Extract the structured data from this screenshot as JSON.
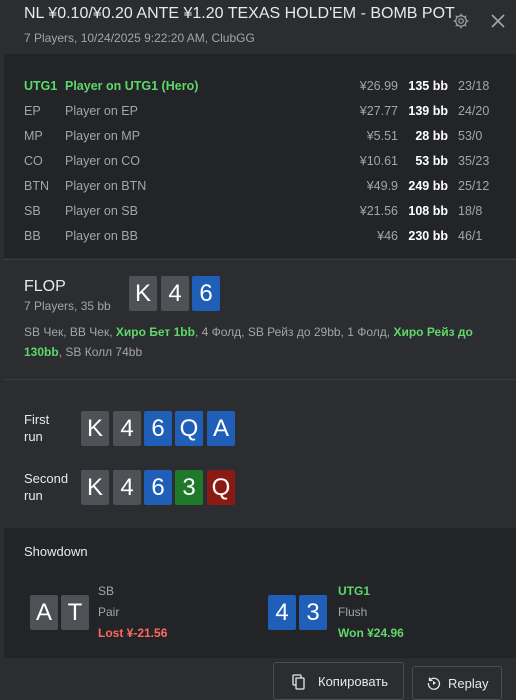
{
  "header": {
    "title": "NL ¥0.10/¥0.20 ANTE ¥1.20 TEXAS HOLD'EM - BOMB POT",
    "subtitle": "7 Players, 10/24/2025 9:22:20 AM, ClubGG",
    "icons": [
      "gear-icon",
      "close-icon"
    ]
  },
  "players": [
    {
      "pos": "UTG1",
      "name": "Player on UTG1 (Hero)",
      "stack": "¥26.99",
      "bb": "135 bb",
      "vp": "23/18",
      "hero": true
    },
    {
      "pos": "EP",
      "name": "Player on EP",
      "stack": "¥27.77",
      "bb": "139 bb",
      "vp": "24/20"
    },
    {
      "pos": "MP",
      "name": "Player on MP",
      "stack": "¥5.51",
      "bb": "28 bb",
      "vp": "53/0"
    },
    {
      "pos": "CO",
      "name": "Player on CO",
      "stack": "¥10.61",
      "bb": "53 bb",
      "vp": "35/23"
    },
    {
      "pos": "BTN",
      "name": "Player on BTN",
      "stack": "¥49.9",
      "bb": "249 bb",
      "vp": "25/12"
    },
    {
      "pos": "SB",
      "name": "Player on SB",
      "stack": "¥21.56",
      "bb": "108 bb",
      "vp": "18/8"
    },
    {
      "pos": "BB",
      "name": "Player on BB",
      "stack": "¥46",
      "bb": "230 bb",
      "vp": "46/1"
    }
  ],
  "flop": {
    "label": "FLOP",
    "sub": "7 Players, 35 bb",
    "cards": [
      "K",
      "4",
      "6"
    ],
    "actions": {
      "a1": "SB Чек, BB Чек, ",
      "a2": "Хиро Бет 1bb",
      "a3": ", 4 Фолд, SB Рейз до 29bb, 1 Фолд, ",
      "a4": "Хиро Рейз до 130bb",
      "a5": ", SB Колл 74bb"
    }
  },
  "runs": {
    "first": {
      "label1": "First",
      "label2": "run",
      "cards": [
        "K",
        "4",
        "6",
        "Q",
        "A"
      ]
    },
    "second": {
      "label1": "Second",
      "label2": "run",
      "cards": [
        "K",
        "4",
        "6",
        "3",
        "Q"
      ]
    }
  },
  "card_colors": {
    "gray": "#4e5156",
    "blue": "#1f5fb8",
    "green": "#1e7a2a",
    "red": "#8b1a14"
  },
  "showdown": {
    "title": "Showdown",
    "left": {
      "cards": [
        "A",
        "T"
      ],
      "pos": "SB",
      "hand": "Pair",
      "result": "Lost ¥-21.56"
    },
    "right": {
      "cards": [
        "4",
        "3"
      ],
      "pos": "UTG1",
      "hand": "Flush",
      "result": "Won ¥24.96"
    }
  },
  "buttons": {
    "copy": "Копировать",
    "replay": "Replay",
    "copy_icon": "copy-icon",
    "replay_icon": "replay-icon"
  },
  "colors": {
    "accent_green": "#5fd86b",
    "lost_red": "#ff6a5c"
  }
}
